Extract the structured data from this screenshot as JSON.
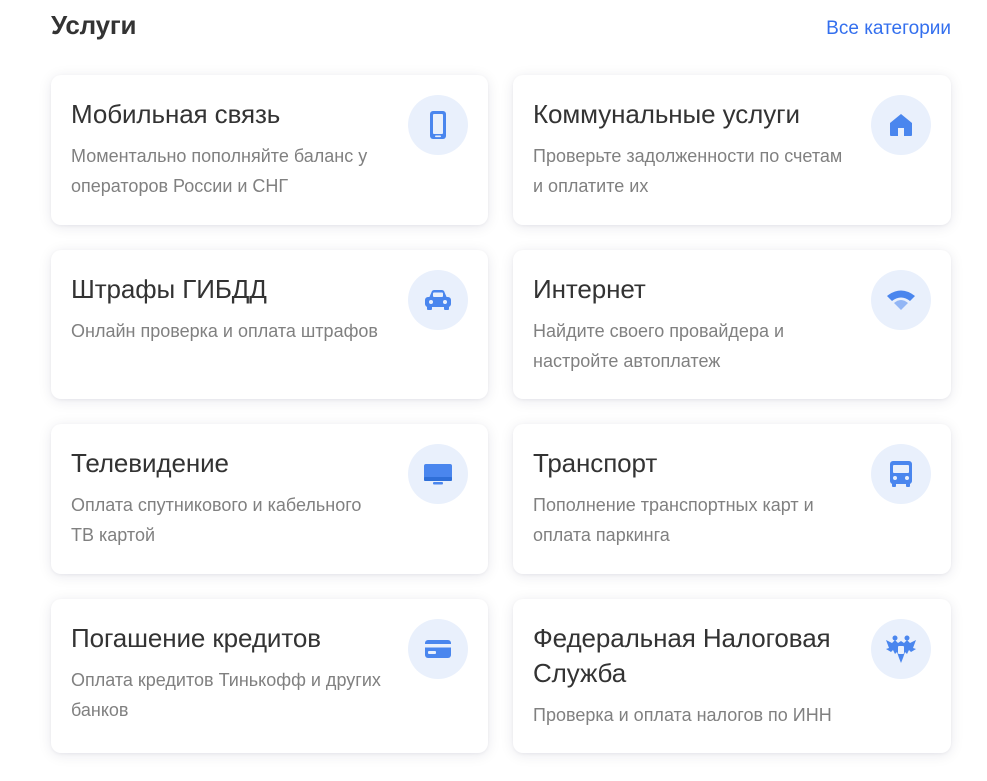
{
  "header": {
    "title": "Услуги",
    "all_link": "Все категории"
  },
  "colors": {
    "accent": "#336fee",
    "icon": "#4a86ee",
    "icon_bg": "#e9f0fc",
    "title": "#333333",
    "description": "#808080"
  },
  "cards": [
    {
      "title": "Мобильная связь",
      "description": "Моментально пополняйте баланс у операторов России и СНГ",
      "icon": "mobile-phone-icon"
    },
    {
      "title": "Коммунальные услуги",
      "description": "Проверьте задолженности по счетам и оплатите их",
      "icon": "house-icon"
    },
    {
      "title": "Штрафы ГИБДД",
      "description": "Онлайн проверка и оплата штрафов",
      "icon": "car-icon"
    },
    {
      "title": "Интернет",
      "description": "Найдите своего провайдера и настройте автоплатеж",
      "icon": "wifi-icon"
    },
    {
      "title": "Телевидение",
      "description": "Оплата спутникового и кабельного ТВ картой",
      "icon": "tv-icon"
    },
    {
      "title": "Транспорт",
      "description": "Пополнение транспортных карт и оплата паркинга",
      "icon": "bus-icon"
    },
    {
      "title": "Погашение кредитов",
      "description": "Оплата кредитов Тинькофф и других банков",
      "icon": "credit-card-icon"
    },
    {
      "title": "Федеральная Налоговая Служба",
      "description": "Проверка и оплата налогов по ИНН",
      "icon": "eagle-emblem-icon"
    }
  ]
}
